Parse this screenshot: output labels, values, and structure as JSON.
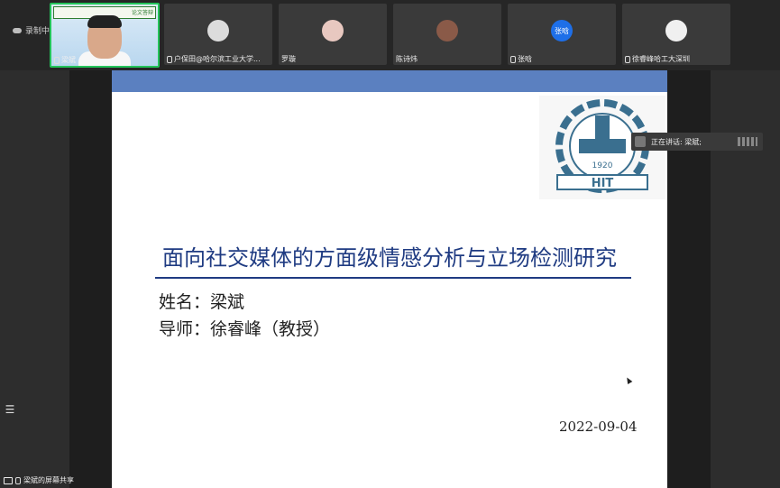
{
  "recording": {
    "label": "录制中"
  },
  "participants": [
    {
      "name": "梁斌",
      "type": "camera",
      "banner": "论文答辩"
    },
    {
      "name": "户保田@哈尔滨工业大学...",
      "type": "avatar"
    },
    {
      "name": "罗璇",
      "type": "avatar"
    },
    {
      "name": "陈诗炜",
      "type": "avatar"
    },
    {
      "name": "张晗",
      "type": "avatar-text",
      "initial": "张晗"
    },
    {
      "name": "徐睿峰哈工大深圳",
      "type": "avatar"
    }
  ],
  "speaking": {
    "label": "正在讲话: 梁斌;"
  },
  "slide": {
    "title": "面向社交媒体的方面级情感分析与立场检测研究",
    "name_line": "姓名：梁斌",
    "advisor_line": "导师：徐睿峰（教授）",
    "date": "2022-09-04",
    "logo_year": "1920",
    "logo_text": "HIT"
  },
  "screen_share": {
    "label": "梁斌的屏幕共享"
  },
  "colors": {
    "slide_bar": "#5b80c0",
    "title": "#1f3b82",
    "active_border": "#24c45a"
  }
}
